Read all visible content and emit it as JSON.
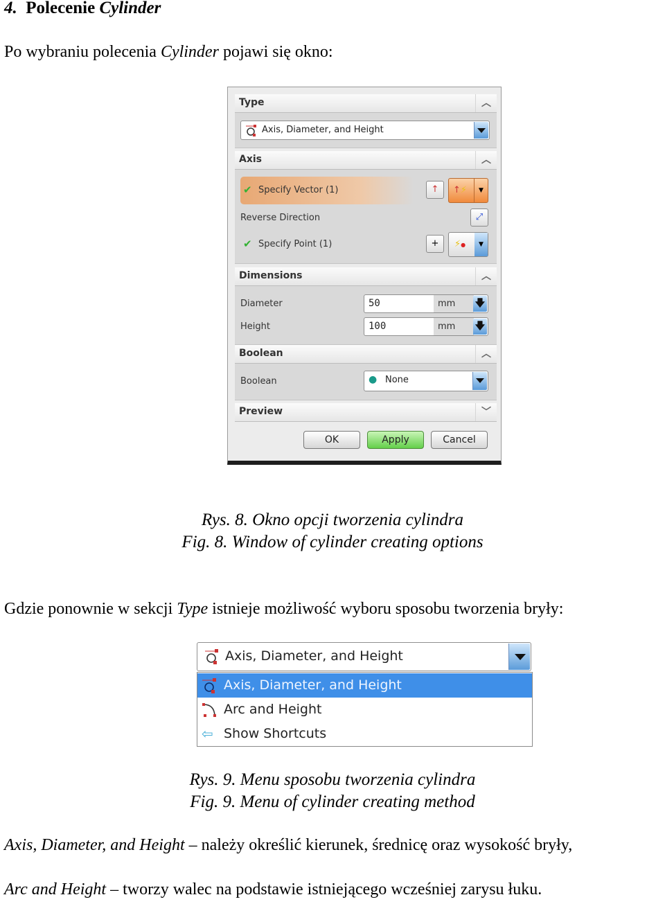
{
  "heading": {
    "number": "4.",
    "text": "Polecenie",
    "italic": "Cylinder"
  },
  "intro": {
    "before": "Po wybraniu polecenia",
    "italic": "Cylinder",
    "after": "pojawi się okno:"
  },
  "dialog": {
    "type_section": {
      "title": "Type",
      "selected": "Axis, Diameter, and Height"
    },
    "axis_section": {
      "title": "Axis",
      "specify_vector": "Specify Vector (1)",
      "reverse_direction": "Reverse Direction",
      "specify_point": "Specify Point (1)"
    },
    "dimensions_section": {
      "title": "Dimensions",
      "diameter_label": "Diameter",
      "diameter_value": "50",
      "diameter_unit": "mm",
      "height_label": "Height",
      "height_value": "100",
      "height_unit": "mm"
    },
    "boolean_section": {
      "title": "Boolean",
      "label": "Boolean",
      "value": "None"
    },
    "preview_section": {
      "title": "Preview"
    },
    "buttons": {
      "ok": "OK",
      "apply": "Apply",
      "cancel": "Cancel"
    }
  },
  "caption8": {
    "pl": "Rys. 8. Okno opcji tworzenia cylindra",
    "en": "Fig. 8. Window of cylinder creating options"
  },
  "para2": {
    "before": "Gdzie ponownie w sekcji",
    "italic": "Type",
    "after": "istnieje możliwość wyboru sposobu tworzenia bryły:"
  },
  "type_menu": {
    "selected": "Axis, Diameter, and Height",
    "options": [
      "Axis, Diameter, and Height",
      "Arc and Height",
      "Show Shortcuts"
    ]
  },
  "caption9": {
    "pl": "Rys. 9. Menu sposobu tworzenia cylindra",
    "en": "Fig. 9. Menu of cylinder creating method"
  },
  "definitions": [
    {
      "term": "Axis, Diameter, and Height",
      "text": "– należy określić kierunek, średnicę oraz wysokość bryły,"
    },
    {
      "term": "Arc and Height",
      "text": "– tworzy walec na podstawie istniejącego wcześniej zarysu łuku."
    }
  ]
}
